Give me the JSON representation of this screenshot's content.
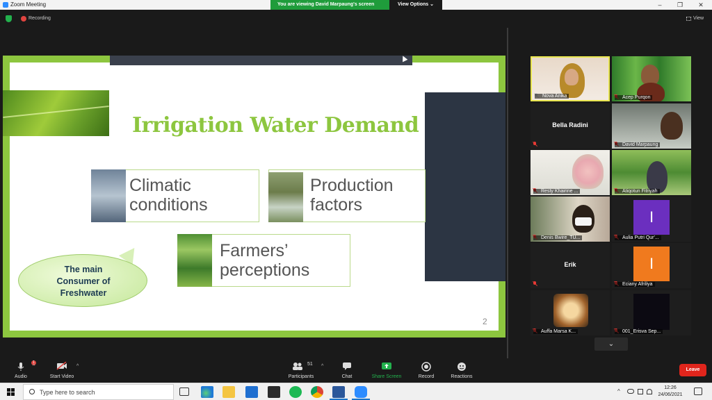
{
  "window": {
    "title": "Zoom Meeting",
    "minimize": "–",
    "maximize": "❐",
    "close": "✕"
  },
  "view_banner": {
    "message": "You are viewing David Marpaung's screen",
    "options_label": "View Options ⌄"
  },
  "topbar": {
    "recording_label": "Recording",
    "view_label": "View"
  },
  "slide": {
    "title": "Irrigation Water Demand",
    "cards": [
      {
        "text_line1": "Climatic",
        "text_line2": "conditions"
      },
      {
        "text_line1": "Production",
        "text_line2": "factors"
      },
      {
        "text_line1": "Farmers’",
        "text_line2": "perceptions"
      }
    ],
    "bubble": "The main Consumer of Freshwater",
    "page_number": "2"
  },
  "participants": [
    {
      "name": "Nova Anika",
      "muted": false
    },
    {
      "name": "Acep Purqon",
      "muted": true
    },
    {
      "name": "Bella Radini",
      "muted": true
    },
    {
      "name": "David Marpaung",
      "muted": true
    },
    {
      "name": "Resty Khairine ...",
      "muted": true
    },
    {
      "name": "Atiqotun Fitriyah",
      "muted": true
    },
    {
      "name": "Denis Bwire_TU...",
      "muted": true
    },
    {
      "name": "Aulia Putri Qur'...",
      "muted": true,
      "initial": "I",
      "color": "#6b2fbf"
    },
    {
      "name": "Erik",
      "muted": true
    },
    {
      "name": "Eciany Afriliya",
      "muted": true,
      "initial": "I",
      "color": "#f07a1e"
    },
    {
      "name": "Auffa Marsa K...",
      "muted": true
    },
    {
      "name": "001_Erisva Sep...",
      "muted": true
    }
  ],
  "scroll_down": "⌄",
  "controls": {
    "audio": "Audio",
    "audio_badge": "1",
    "start_video": "Start Video",
    "participants": "Participants",
    "participants_count": "51",
    "chat": "Chat",
    "share_screen": "Share Screen",
    "record": "Record",
    "reactions": "Reactions",
    "leave": "Leave",
    "caret": "^"
  },
  "taskbar": {
    "search_placeholder": "Type here to search",
    "time": "12:26",
    "date": "24/06/2021",
    "tray_expand": "^"
  },
  "colors": {
    "slide_green": "#8dc63f",
    "share_green": "#1f9c3b",
    "leave_red": "#e0251c",
    "active_speaker": "#e9e64f"
  }
}
